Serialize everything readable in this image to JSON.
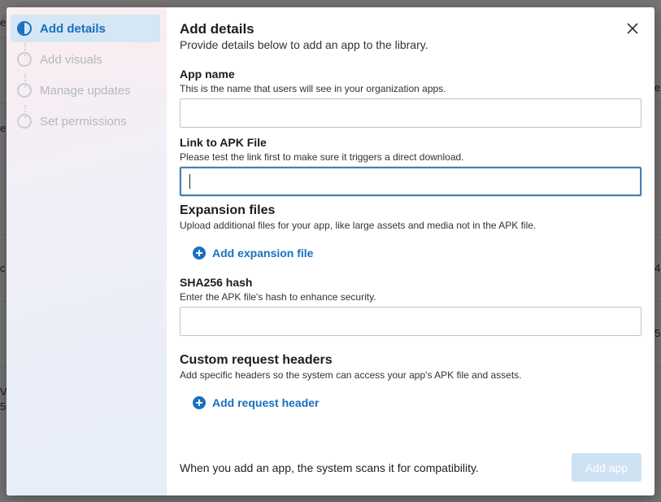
{
  "background": {
    "fragments": [
      "e",
      "e",
      "c",
      "V",
      "5",
      "e",
      "4",
      "5"
    ]
  },
  "stepper": {
    "steps": [
      {
        "label": "Add details",
        "state": "active"
      },
      {
        "label": "Add visuals",
        "state": "inactive"
      },
      {
        "label": "Manage updates",
        "state": "inactive"
      },
      {
        "label": "Set permissions",
        "state": "inactive"
      }
    ]
  },
  "dialog": {
    "title": "Add details",
    "subtitle": "Provide details below to add an app to the library.",
    "close_icon": "close-icon"
  },
  "app_name": {
    "label": "App name",
    "help": "This is the name that users will see in your organization apps.",
    "value": ""
  },
  "apk_link": {
    "label": "Link to APK File",
    "help": "Please test the link first to make sure it triggers a direct download.",
    "value": ""
  },
  "expansion_files": {
    "title": "Expansion files",
    "help": "Upload additional files for your app, like large assets and media not in the APK file.",
    "add_label": "Add expansion file"
  },
  "sha256": {
    "label": "SHA256 hash",
    "help": "Enter the APK file's hash to enhance security.",
    "value": ""
  },
  "request_headers": {
    "title": "Custom request headers",
    "help": "Add specific headers so the system can access your app's APK file and assets.",
    "add_label": "Add request header"
  },
  "footer": {
    "note": "When you add an app, the system scans it for compatibility.",
    "submit_label": "Add app"
  },
  "colors": {
    "accent": "#1a6fbf",
    "disabled_button": "#cfe2f4"
  }
}
